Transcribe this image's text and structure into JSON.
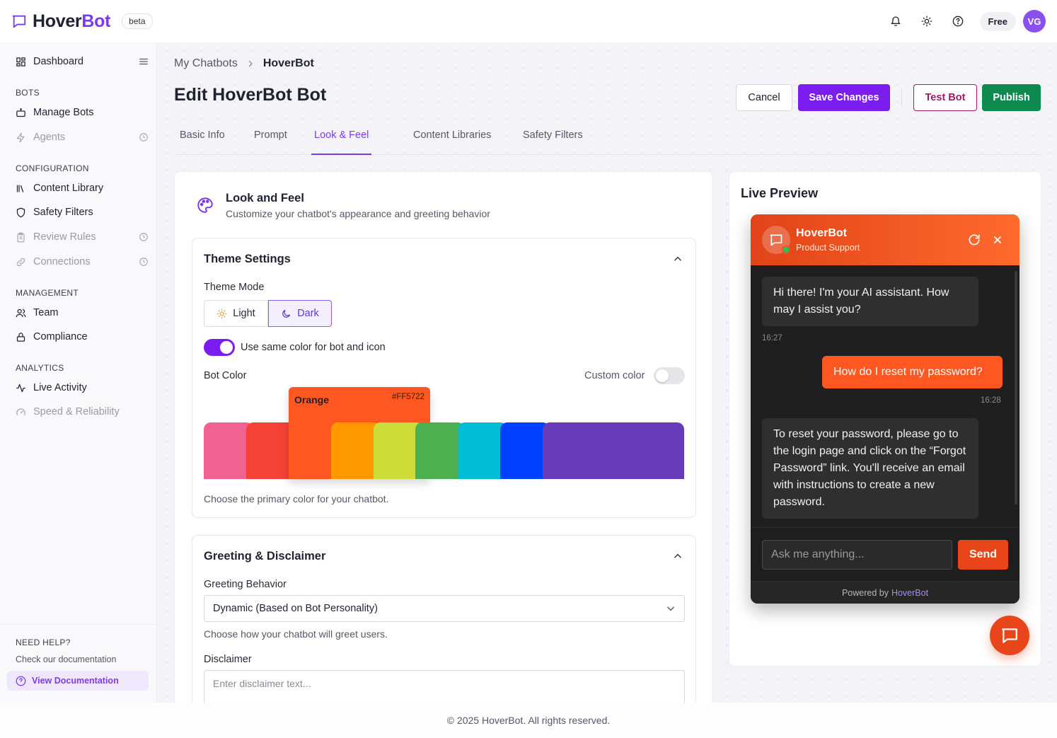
{
  "brand": {
    "name_part1": "Hover",
    "name_part2": "Bot",
    "badge": "beta"
  },
  "topbar": {
    "plan": "Free",
    "avatar_initials": "VG"
  },
  "sidebar": {
    "dashboard": "Dashboard",
    "sections": {
      "bots": "BOTS",
      "configuration": "CONFIGURATION",
      "management": "MANAGEMENT",
      "analytics": "ANALYTICS"
    },
    "items": {
      "manage_bots": "Manage Bots",
      "agents": "Agents",
      "content_library": "Content Library",
      "safety_filters": "Safety Filters",
      "review_rules": "Review Rules",
      "connections": "Connections",
      "team": "Team",
      "compliance": "Compliance",
      "live_activity": "Live Activity",
      "speed_reliability": "Speed & Reliability"
    },
    "help": {
      "title": "NEED HELP?",
      "subtitle": "Check our documentation",
      "button": "View Documentation"
    }
  },
  "breadcrumb": {
    "parent": "My Chatbots",
    "current": "HoverBot"
  },
  "page_title": "Edit HoverBot Bot",
  "actions": {
    "cancel": "Cancel",
    "save": "Save Changes",
    "test": "Test Bot",
    "publish": "Publish"
  },
  "tabs": [
    "Basic Info",
    "Prompt",
    "Look & Feel",
    "Content Libraries",
    "Safety Filters"
  ],
  "active_tab": "Look & Feel",
  "look_feel": {
    "title": "Look and Feel",
    "subtitle": "Customize your chatbot's appearance and greeting behavior",
    "theme": {
      "title": "Theme Settings",
      "mode_label": "Theme Mode",
      "light": "Light",
      "dark": "Dark",
      "selected_mode": "Dark",
      "same_color_label": "Use same color for bot and icon",
      "same_color_on": true,
      "bot_color_label": "Bot Color",
      "custom_color_label": "Custom color",
      "custom_color_on": false,
      "selected_color_name": "Orange",
      "selected_color_hex": "#FF5722",
      "palette": [
        "#f06292",
        "#f44336",
        "#ff5722",
        "#ff9800",
        "#cddc39",
        "#4caf50",
        "#00bcd4",
        "#0040ff",
        "#673ab7"
      ],
      "helper": "Choose the primary color for your chatbot."
    },
    "greeting": {
      "title": "Greeting & Disclaimer",
      "behavior_label": "Greeting Behavior",
      "behavior_value": "Dynamic (Based on Bot Personality)",
      "behavior_helper": "Choose how your chatbot will greet users.",
      "disclaimer_label": "Disclaimer",
      "disclaimer_placeholder": "Enter disclaimer text..."
    }
  },
  "preview": {
    "title": "Live Preview",
    "bot_name": "HoverBot",
    "bot_role": "Product Support",
    "messages": [
      {
        "from": "bot",
        "text": "Hi there! I'm your AI assistant. How may I assist you?",
        "time": "16:27"
      },
      {
        "from": "user",
        "text": "How do I reset my password?",
        "time": "16:28"
      },
      {
        "from": "bot",
        "text": "To reset your password, please go to the login page and click on the “Forgot Password” link. You'll receive an email with instructions to create a new password."
      }
    ],
    "input_placeholder": "Ask me anything...",
    "send": "Send",
    "powered_by": "Powered by",
    "powered_brand": "HoverBot"
  },
  "footer": "© 2025 HoverBot. All rights reserved.",
  "colors": {
    "accent": "#7c1df0",
    "publish": "#0e8a4f",
    "test_border": "#9c1c6a",
    "bot_color": "#FF5722"
  }
}
